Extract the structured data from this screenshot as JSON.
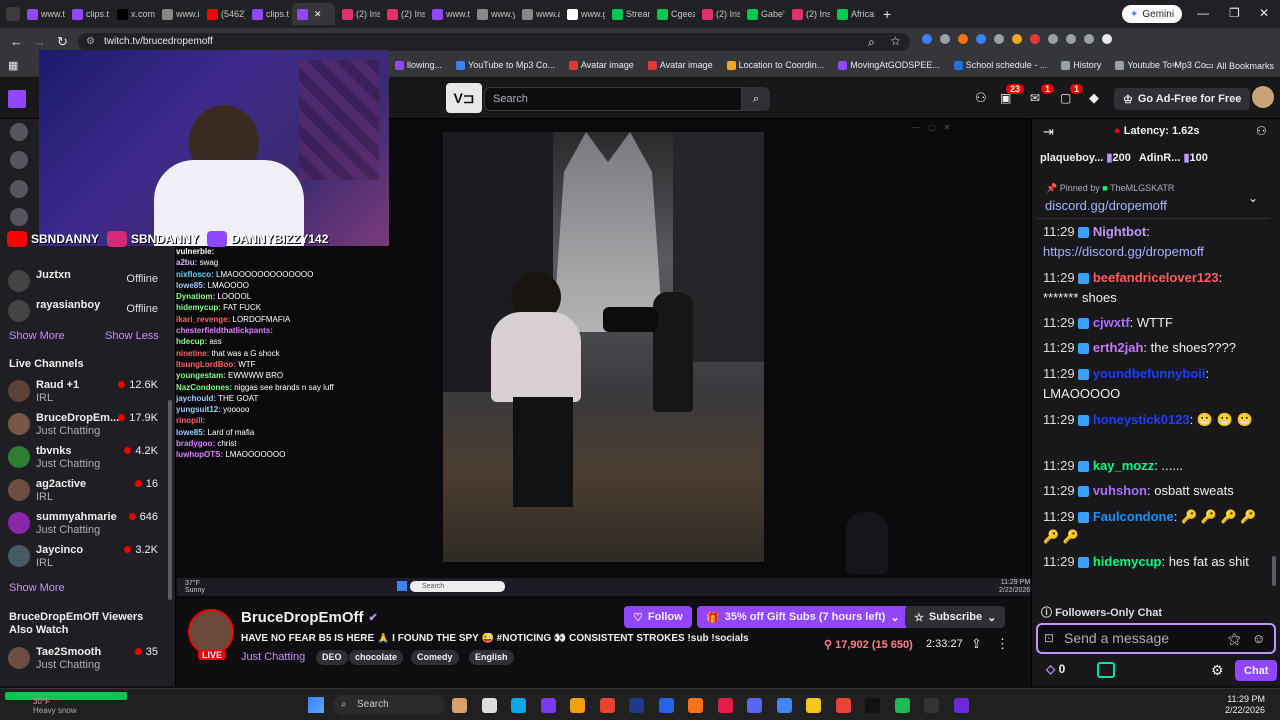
{
  "browser": {
    "tabs": [
      {
        "label": "www.t",
        "color": "#9146ff"
      },
      {
        "label": "clips.t",
        "color": "#9146ff"
      },
      {
        "label": "x.com",
        "color": "#000000"
      },
      {
        "label": "www.i",
        "color": "#888888"
      },
      {
        "label": "(5462)",
        "color": "#ff0000"
      },
      {
        "label": "clips.t",
        "color": "#9146ff"
      },
      {
        "label": "",
        "color": "#9146ff"
      },
      {
        "label": "(2) Ins",
        "color": "#e1306c"
      },
      {
        "label": "(2) Ins",
        "color": "#e1306c"
      },
      {
        "label": "www.t",
        "color": "#9146ff"
      },
      {
        "label": "www.y",
        "color": "#888888"
      },
      {
        "label": "www.a",
        "color": "#888888"
      },
      {
        "label": "www.g",
        "color": "#ffffff"
      },
      {
        "label": "Stream",
        "color": "#00c853"
      },
      {
        "label": "Cgeez",
        "color": "#00c853"
      },
      {
        "label": "(2) Ins",
        "color": "#e1306c"
      },
      {
        "label": "Gabe's",
        "color": "#00c853"
      },
      {
        "label": "(2) Ins",
        "color": "#e1306c"
      },
      {
        "label": "Africa!",
        "color": "#00c853"
      }
    ],
    "new_tab": "+",
    "gemini_label": "Gemini",
    "url": "twitch.tv/brucedropemoff",
    "bookmarks": [
      {
        "label": "llowing...",
        "icon": "#9146ff"
      },
      {
        "label": "YouTube to Mp3 Co...",
        "icon": "#3b82f6"
      },
      {
        "label": "Avatar image",
        "icon": "#e53935"
      },
      {
        "label": "Avatar image",
        "icon": "#e53935"
      },
      {
        "label": "Location to Coordin...",
        "icon": "#f5a623"
      },
      {
        "label": "MovingAtGODSPEE...",
        "icon": "#9146ff"
      },
      {
        "label": "School schedule - ...",
        "icon": "#1a73e8"
      },
      {
        "label": "History",
        "icon": "#9aa0a6"
      },
      {
        "label": "Youtube To Mp3 Co...",
        "icon": "#9aa0a6"
      }
    ],
    "all_bookmarks": "All Bookmarks"
  },
  "twitch": {
    "search_placeholder": "Search",
    "notif_count": "23",
    "inbox_count": "1",
    "whisper_count": "1",
    "ad_free_label": "Go Ad-Free for Free"
  },
  "sidebar": {
    "followed": [
      {
        "name": "Juztxn",
        "status": "Offline"
      },
      {
        "name": "rayasianboy",
        "status": "Offline"
      }
    ],
    "show_more": "Show More",
    "show_less": "Show Less",
    "live_header": "Live Channels",
    "live": [
      {
        "name": "Raud +1",
        "cat": "IRL",
        "viewers": "12.6K",
        "color": "#5d4037"
      },
      {
        "name": "BruceDropEm...",
        "cat": "Just Chatting",
        "viewers": "17.9K",
        "color": "#795548"
      },
      {
        "name": "tbvnks",
        "cat": "Just Chatting",
        "viewers": "4.2K",
        "color": "#2e7d32"
      },
      {
        "name": "ag2active",
        "cat": "IRL",
        "viewers": "16",
        "color": "#6d4c41"
      },
      {
        "name": "summyahmarie",
        "cat": "Just Chatting",
        "viewers": "646",
        "color": "#8e24aa"
      },
      {
        "name": "Jaycinco",
        "cat": "IRL",
        "viewers": "3.2K",
        "color": "#455a64"
      }
    ],
    "show_more2": "Show More",
    "also_watch_header": "BruceDropEmOff Viewers Also Watch",
    "also": [
      {
        "name": "Tae2Smooth",
        "cat": "Just Chatting",
        "viewers": "35"
      }
    ]
  },
  "video": {
    "overlay_handles": [
      {
        "icon": "youtube-icon",
        "name": "SBNDANNY",
        "color": "#ff0000"
      },
      {
        "icon": "instagram-icon",
        "name": "SBNDANNY",
        "color": "#d62976"
      },
      {
        "icon": "twitch-icon",
        "name": "DANNYBIZZY142",
        "color": "#9146ff"
      }
    ],
    "overlay_chat": [
      {
        "u": "vulnerble:",
        "t": "",
        "c": "#ffffff"
      },
      {
        "u": "a2bu:",
        "t": "swag",
        "c": "#d4b4ff"
      },
      {
        "u": "nixflosco:",
        "t": "LMAOOOOOOOOOOOOO",
        "c": "#6bd3ff"
      },
      {
        "u": "lowe85:",
        "t": "LMAOOOO",
        "c": "#9cf"
      },
      {
        "u": "Dynatiom:",
        "t": "LOOOOL",
        "c": "#7fff7f"
      },
      {
        "u": "hidemycup:",
        "t": "FAT FUCK",
        "c": "#7fff7f"
      },
      {
        "u": "ikari_revenge:",
        "t": "LORDOFMAFIA",
        "c": "#ff6060"
      },
      {
        "u": "chesterfieldthatlickpants:",
        "t": "",
        "c": "#e080ff"
      },
      {
        "u": "hdecup:",
        "t": "ass",
        "c": "#7fff7f"
      },
      {
        "u": "ninetine:",
        "t": "that was a G shock",
        "c": "#ff6060"
      },
      {
        "u": "ItsungLordBoo:",
        "t": "WTF",
        "c": "#ff6060"
      },
      {
        "u": "youngestam:",
        "t": "EWWWW BRO",
        "c": "#7fff7f"
      },
      {
        "u": "NazCondones:",
        "t": "niggas see brands n say luff",
        "c": "#7fff7f"
      },
      {
        "u": "jaychould:",
        "t": "THE GOAT",
        "c": "#9cf"
      },
      {
        "u": "yungsuit12:",
        "t": "yooooo",
        "c": "#9cf"
      },
      {
        "u": "rinopill:",
        "t": "",
        "c": "#ff6060"
      },
      {
        "u": "lowe85:",
        "t": "Lard of mafia",
        "c": "#9cf"
      },
      {
        "u": "bradygoo:",
        "t": "christ",
        "c": "#e080ff"
      },
      {
        "u": "luwhopOTS:",
        "t": "LMAOOOOOOO",
        "c": "#e080ff"
      }
    ],
    "mini_taskbar_temp": "37°F",
    "mini_taskbar_time": "11:29 PM",
    "mini_taskbar_date": "2/22/2026",
    "mini_weather": "Sunny",
    "mini_search": "Search"
  },
  "stream": {
    "channel": "BruceDropEmOff",
    "live_badge": "LIVE",
    "follow": "Follow",
    "gift": "35% off Gift Subs (7 hours left)",
    "subscribe": "Subscribe",
    "title": "HAVE NO FEAR B5 IS HERE 🙏 I FOUND THE SPY 😜 #NOTICING 👀 CONSISTENT STROKES !sub !socials",
    "category": "Just Chatting",
    "tags": [
      "DEO",
      "chocolate",
      "Comedy",
      "English"
    ],
    "viewers": "17,902 (15 650)",
    "uptime": "2:33:27"
  },
  "chat": {
    "latency": "Latency: 1.62s",
    "gifters": [
      {
        "name": "plaqueboy...",
        "count": "200"
      },
      {
        "name": "AdinR...",
        "count": "100"
      }
    ],
    "pinned_by": "Pinned by",
    "pinned_user": "TheMLGSKATR",
    "pinned_text": "discord.gg/dropemoff",
    "messages": [
      {
        "ts": "11:29",
        "user": "Nightbot",
        "color": "#bf94ff",
        "text": "https://discord.gg/dropemoff",
        "textColor": "#a5b4fc"
      },
      {
        "ts": "11:29",
        "user": "beefandricelover123",
        "color": "#ff5d5d",
        "text": "******* shoes",
        "textColor": "#efeff1"
      },
      {
        "ts": "11:29",
        "user": "cjwxtf",
        "color": "#a970ff",
        "text": "WTTF",
        "textColor": "#efeff1"
      },
      {
        "ts": "11:29",
        "user": "erth2jah",
        "color": "#c678ff",
        "text": "the shoes????",
        "textColor": "#efeff1"
      },
      {
        "ts": "11:29",
        "user": "youndbefunnyboii",
        "color": "#1e3cff",
        "text": "LMAOOOOO",
        "textColor": "#efeff1"
      },
      {
        "ts": "11:29",
        "user": "honeystick0123",
        "color": "#1e3cff",
        "text": "😬 😬 😬",
        "textColor": "#efeff1"
      },
      {
        "ts": "11:29",
        "user": "kay_mozz",
        "color": "#00ff7f",
        "text": "......",
        "textColor": "#efeff1"
      },
      {
        "ts": "11:29",
        "user": "vuhshon",
        "color": "#a970ff",
        "text": "osbatt sweats",
        "textColor": "#efeff1"
      },
      {
        "ts": "11:29",
        "user": "Faulcondone",
        "color": "#1e90ff",
        "text": "🔑 🔑 🔑 🔑 🔑 🔑",
        "textColor": "#efeff1"
      },
      {
        "ts": "11:29",
        "user": "hidemycup",
        "color": "#00ff7f",
        "text": "hes fat as shit",
        "textColor": "#efeff1"
      }
    ],
    "followers_only": "Followers-Only Chat",
    "input_placeholder": "Send a message",
    "points": "0",
    "chat_button": "Chat"
  },
  "taskbar": {
    "search": "Search",
    "time": "11:29 PM",
    "date": "2/22/2026",
    "weather_temp": "30°F",
    "weather_text": "Heavy snow"
  }
}
